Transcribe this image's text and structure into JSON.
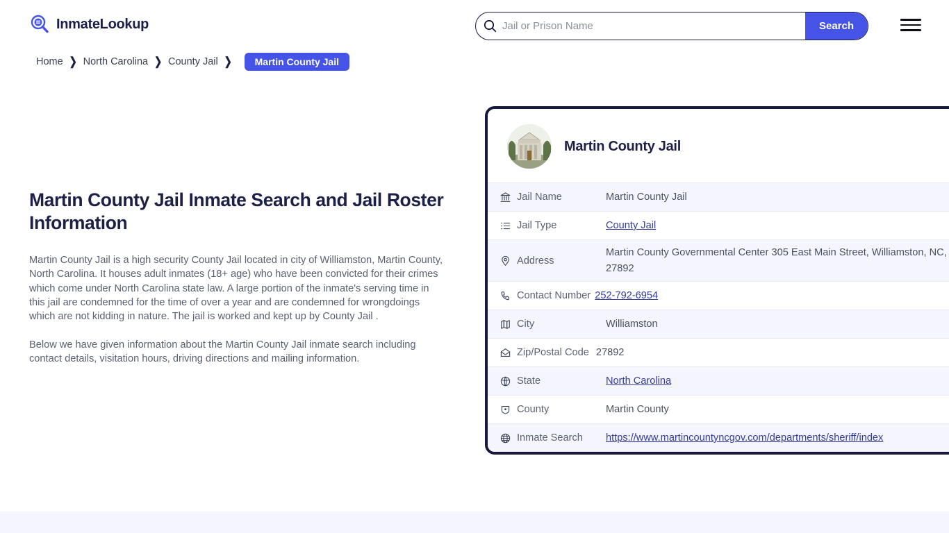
{
  "header": {
    "brand_name": "InmateLookup",
    "brand_icon": "magnifier-logo-icon",
    "menu_icon": "hamburger-menu-icon",
    "search": {
      "placeholder": "Jail or Prison Name",
      "value": "",
      "icon": "search-icon",
      "button_label": "Search"
    }
  },
  "breadcrumb": {
    "items": [
      {
        "label": "Home",
        "current": false
      },
      {
        "label": "North Carolina",
        "current": false
      },
      {
        "label": "County Jail",
        "current": false
      },
      {
        "label": "Martin County Jail",
        "current": true
      }
    ],
    "separator_icon": "chevron-right-icon"
  },
  "main": {
    "title": "Martin County Jail Inmate Search and Jail Roster Information",
    "paragraphs": [
      "Martin County Jail is a high security County Jail located in city of Williamston, Martin County, North Carolina. It houses adult inmates (18+ age) who have been convicted for their crimes which come under North Carolina state law. A large portion of the inmate's serving time in this jail are condemned for the time of over a year and are condemned for wrongdoings which are not kidding in nature. The jail is worked and kept up by County Jail .",
      "Below we have given information about the Martin County Jail inmate search including contact details, visitation hours, driving directions and mailing information."
    ]
  },
  "card": {
    "title": "Martin County Jail",
    "avatar_icon": "courthouse-photo",
    "rows": [
      {
        "icon": "bank-icon",
        "label": "Jail Name",
        "value": "Martin County Jail",
        "is_link": false
      },
      {
        "icon": "list-icon",
        "label": "Jail Type",
        "value": "County Jail",
        "is_link": true
      },
      {
        "icon": "location-pin-icon",
        "label": "Address",
        "value": "Martin County Governmental Center 305 East Main Street, Williamston, NC, 27892",
        "is_link": false
      },
      {
        "icon": "phone-icon",
        "label": "Contact Number",
        "value": "252-792-6954",
        "is_link": true
      },
      {
        "icon": "map-icon",
        "label": "City",
        "value": "Williamston",
        "is_link": false
      },
      {
        "icon": "envelope-icon",
        "label": "Zip/Postal Code",
        "value": "27892",
        "is_link": false
      },
      {
        "icon": "globe-icon",
        "label": "State",
        "value": "North Carolina",
        "is_link": true
      },
      {
        "icon": "badge-icon",
        "label": "County",
        "value": "Martin County",
        "is_link": false
      },
      {
        "icon": "web-globe-icon",
        "label": "Inmate Search",
        "value": "https://www.martincountyncgov.com/departments/sheriff/index",
        "is_link": true
      }
    ]
  },
  "colors": {
    "accent": "#4553e6",
    "ink": "#1d2046",
    "card_border": "#16193d",
    "stripe": "#f5f6fd",
    "link": "#343b9e",
    "footer_band": "#f5f5fd"
  }
}
